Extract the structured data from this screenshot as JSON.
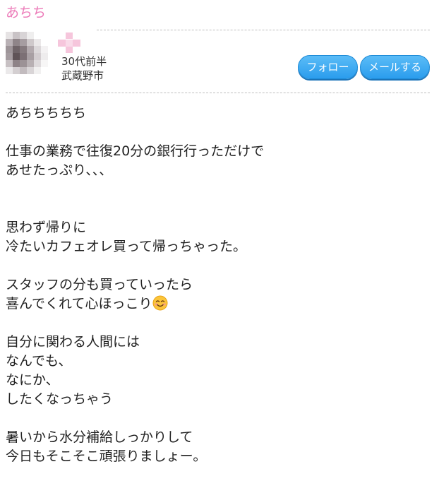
{
  "post": {
    "title": "あちち"
  },
  "profile": {
    "age": "30代前半",
    "area": "武蔵野市",
    "avatar_icon": "blurred-photo-avatar",
    "badge_icon": "pink-flower-icon"
  },
  "buttons": {
    "follow_label": "フォロー",
    "mail_label": "メールする"
  },
  "body": {
    "lines": [
      "あちちちちち",
      "",
      "仕事の業務で往復20分の銀行行っただけで",
      "あせたっぷり、、、",
      "",
      "",
      "思わず帰りに",
      "冷たいカフェオレ買って帰っちゃった。",
      "",
      "スタッフの分も買っていったら",
      "喜んでくれて心ほっこり",
      "",
      "自分に関わる人間には",
      "なんでも、",
      "なにか、",
      "したくなっちゃう",
      "",
      "暑いから水分補給しっかりして",
      "今日もそこそこ頑張りましょー。"
    ],
    "emoji_icon": "smiling-face-emoji"
  },
  "colors": {
    "title_pink": "#ec7ab8",
    "button_blue": "#2b9ded",
    "divider_gray": "#bdbdbd"
  }
}
